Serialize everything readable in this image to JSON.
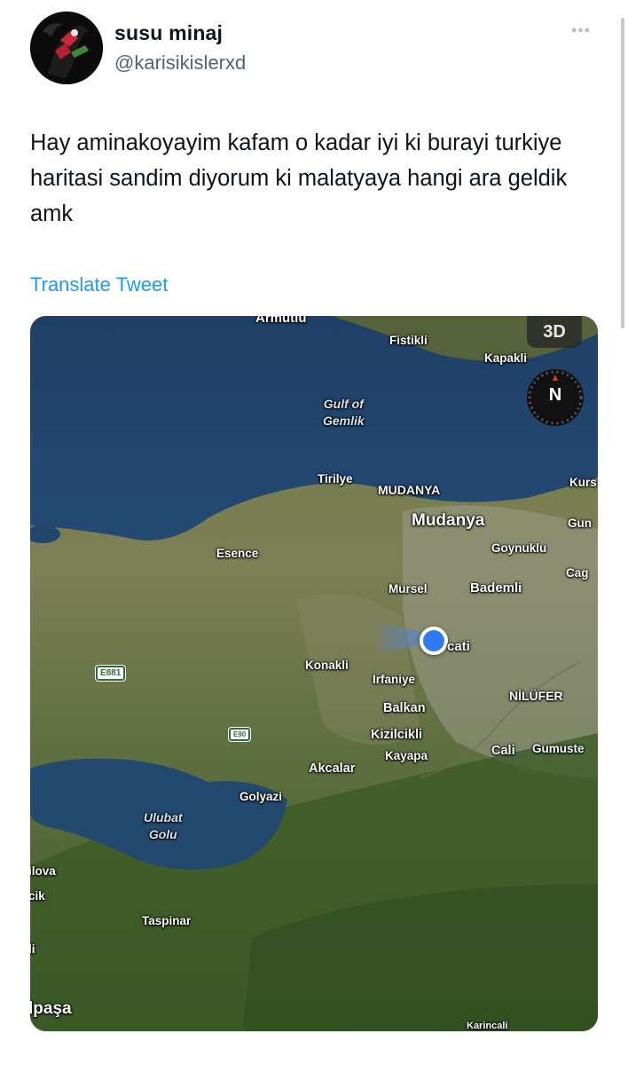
{
  "user": {
    "display_name": "susu minaj",
    "handle": "@karisikislerxd"
  },
  "more_icon": "more-dots-icon",
  "tweet": {
    "text": "Hay aminakoyayim kafam o kadar iyi ki burayi turkiye haritasi sandim diyorum ki malatyaya hangi ara geldik amk",
    "translate_label": "Translate Tweet"
  },
  "map": {
    "view_toggle": "3D",
    "compass": "N",
    "labels": {
      "armutlu": "Armutlu",
      "fistikli": "Fistikli",
      "kapakli": "Kapakli",
      "gulf": "Gulf of\nGemlik",
      "tirilye": "Tirilye",
      "mudanya_caps": "MUDANYA",
      "mudanya": "Mudanya",
      "kurs": "Kurs",
      "gun": "Gun",
      "esence": "Esence",
      "goynuklu": "Goynuklu",
      "cag": "Cag",
      "mursel": "Mursel",
      "bademli": "Bademli",
      "cati": "cati",
      "konakli": "Konakli",
      "irfaniye": "Irfaniye",
      "nilufer": "NİLÜFER",
      "balkan": "Balkan",
      "kizilcikli": "Kizilcikli",
      "kayapa": "Kayapa",
      "cali": "Cali",
      "gumuste": "Gumuste",
      "akcalar": "Akcalar",
      "golyazi": "Golyazi",
      "ulubat": "Ulubat\nGolu",
      "ilova": "ilova",
      "cik": "cik",
      "li": "li",
      "taspinar": "Taspinar",
      "ipasa": "lpaşa",
      "karincali": "Karincali"
    },
    "roads": {
      "e881": "E881",
      "e90": "E90"
    }
  }
}
